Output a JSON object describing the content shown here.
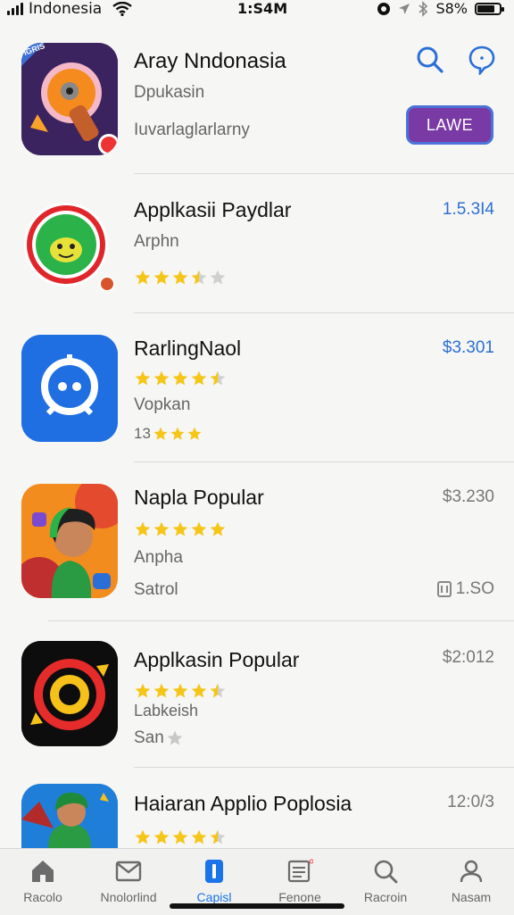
{
  "status_bar": {
    "carrier": "Indonesia",
    "time": "1:S4M",
    "battery": "S8%",
    "battery_level": 0.8
  },
  "header": {
    "title": "Aray Nndonasia",
    "subtitle": "Dpukasin",
    "category": "Iuvarlaglarlarny",
    "badge": "IGRIS",
    "action_label": "LAWE",
    "search_icon": "search-icon",
    "chat_icon": "chat-bubble-icon"
  },
  "apps": [
    {
      "title": "Applkasii Paydlar",
      "subtitle": "Arphn",
      "price": "1.5.3I4",
      "rating": 3.5
    },
    {
      "title": "RarlingNaol",
      "price": "$3.301",
      "rating": 4.5,
      "subtitle": "Vopkan",
      "meta": "13"
    },
    {
      "title": "Napla Popular",
      "price": "$3.230",
      "rating": 5,
      "subtitle": "Anpha",
      "meta": "Satrol",
      "size": "1.SO"
    },
    {
      "title": "Applkasin Popular",
      "price": "$2:012",
      "rating": 4.5,
      "subtitle": "Labkeish",
      "meta": "San"
    },
    {
      "title": "Haiaran Applio Poplosia",
      "price": "12:0/3",
      "rating": 4.5
    }
  ],
  "tabbar": [
    {
      "label": "Racolo",
      "icon": "home-icon"
    },
    {
      "label": "Nnolorlind",
      "icon": "inbox-icon"
    },
    {
      "label": "Capisl",
      "icon": "apps-icon",
      "active": true
    },
    {
      "label": "Fenone",
      "icon": "list-icon"
    },
    {
      "label": "Racroin",
      "icon": "search-icon"
    },
    {
      "label": "Nasam",
      "icon": "person-icon"
    }
  ],
  "colors": {
    "accent": "#2b6fd6",
    "button": "#7a3aa6",
    "star": "#f5c518"
  }
}
